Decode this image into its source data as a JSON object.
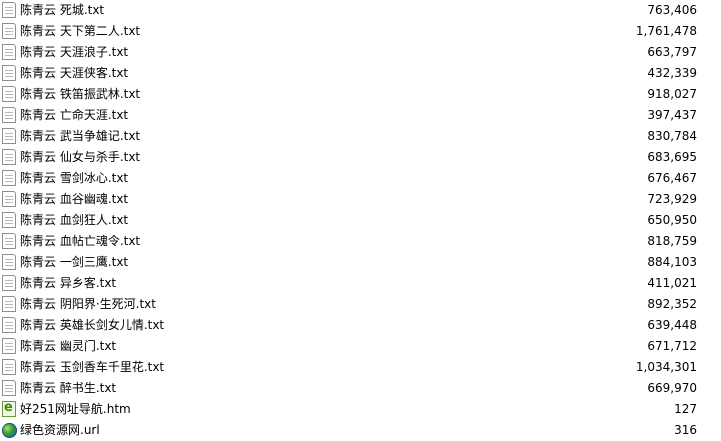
{
  "files": [
    {
      "name": "陈青云 死城.txt",
      "size": "763,406",
      "icon": "text-file-icon"
    },
    {
      "name": "陈青云 天下第二人.txt",
      "size": "1,761,478",
      "icon": "text-file-icon"
    },
    {
      "name": "陈青云 天涯浪子.txt",
      "size": "663,797",
      "icon": "text-file-icon"
    },
    {
      "name": "陈青云 天涯侠客.txt",
      "size": "432,339",
      "icon": "text-file-icon"
    },
    {
      "name": "陈青云 铁笛振武林.txt",
      "size": "918,027",
      "icon": "text-file-icon"
    },
    {
      "name": "陈青云 亡命天涯.txt",
      "size": "397,437",
      "icon": "text-file-icon"
    },
    {
      "name": "陈青云 武当争雄记.txt",
      "size": "830,784",
      "icon": "text-file-icon"
    },
    {
      "name": "陈青云 仙女与杀手.txt",
      "size": "683,695",
      "icon": "text-file-icon"
    },
    {
      "name": "陈青云 雪剑冰心.txt",
      "size": "676,467",
      "icon": "text-file-icon"
    },
    {
      "name": "陈青云 血谷幽魂.txt",
      "size": "723,929",
      "icon": "text-file-icon"
    },
    {
      "name": "陈青云 血剑狂人.txt",
      "size": "650,950",
      "icon": "text-file-icon"
    },
    {
      "name": "陈青云 血帖亡魂令.txt",
      "size": "818,759",
      "icon": "text-file-icon"
    },
    {
      "name": "陈青云 一剑三鹰.txt",
      "size": "884,103",
      "icon": "text-file-icon"
    },
    {
      "name": "陈青云 异乡客.txt",
      "size": "411,021",
      "icon": "text-file-icon"
    },
    {
      "name": "陈青云 阴阳界·生死河.txt",
      "size": "892,352",
      "icon": "text-file-icon"
    },
    {
      "name": "陈青云 英雄长剑女儿情.txt",
      "size": "639,448",
      "icon": "text-file-icon"
    },
    {
      "name": "陈青云 幽灵门.txt",
      "size": "671,712",
      "icon": "text-file-icon"
    },
    {
      "name": "陈青云 玉剑香车千里花.txt",
      "size": "1,034,301",
      "icon": "text-file-icon"
    },
    {
      "name": "陈青云 醉书生.txt",
      "size": "669,970",
      "icon": "text-file-icon"
    },
    {
      "name": "好251网址导航.htm",
      "size": "127",
      "icon": "html-file-icon"
    },
    {
      "name": "绿色资源网.url",
      "size": "316",
      "icon": "globe-icon"
    }
  ]
}
